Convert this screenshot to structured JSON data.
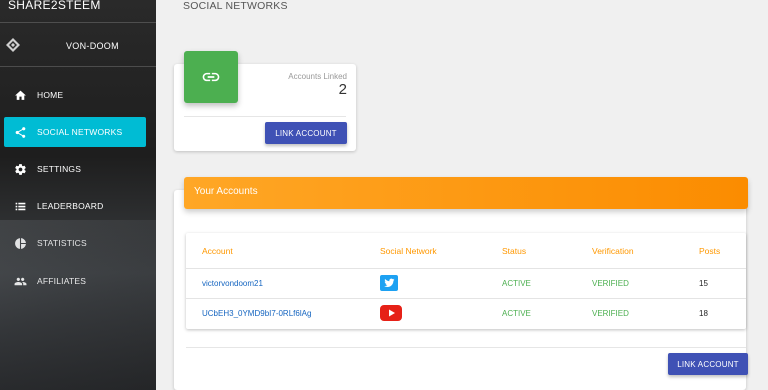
{
  "sidebar": {
    "brand": "SHARE2STEEM",
    "user_name": "VON-DOOM",
    "items": [
      {
        "label": "HOME",
        "icon": "home-icon",
        "active": false
      },
      {
        "label": "SOCIAL NETWORKS",
        "icon": "share-icon",
        "active": true
      },
      {
        "label": "SETTINGS",
        "icon": "gear-icon",
        "active": false
      },
      {
        "label": "LEADERBOARD",
        "icon": "list-icon",
        "active": false
      },
      {
        "label": "STATISTICS",
        "icon": "pie-chart-icon",
        "active": false
      },
      {
        "label": "AFFILIATES",
        "icon": "people-icon",
        "active": false
      }
    ],
    "active_color": "#00bcd4"
  },
  "main": {
    "title": "SOCIAL NETWORKS",
    "stat": {
      "label": "Accounts Linked",
      "value": "2",
      "button": "LINK ACCOUNT",
      "icon": "link-icon",
      "color": "#4caf50"
    },
    "accounts": {
      "header": "Your Accounts",
      "header_color": "#fb8c00",
      "columns": [
        "Account",
        "Social Network",
        "Status",
        "Verification",
        "Posts"
      ],
      "rows": [
        {
          "account": "victorvondoom21",
          "network": "twitter-icon",
          "status": "ACTIVE",
          "verification": "VERIFIED",
          "posts": "15"
        },
        {
          "account": "UCbEH3_0YMD9bI7-0RLf6lAg",
          "network": "youtube-icon",
          "status": "ACTIVE",
          "verification": "VERIFIED",
          "posts": "18"
        }
      ],
      "button": "LINK ACCOUNT"
    }
  }
}
